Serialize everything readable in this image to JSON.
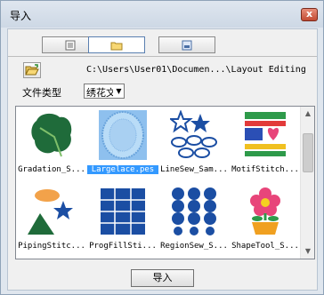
{
  "window": {
    "title": "导入",
    "close_glyph": "x"
  },
  "tabs": [
    {
      "icon": "list-icon",
      "selected": false
    },
    {
      "icon": "folder-icon",
      "selected": true
    },
    {
      "icon": "picture-icon",
      "selected": false
    }
  ],
  "folder": {
    "open_icon": "open-folder-icon",
    "path": "C:\\Users\\User01\\Documen...\\Layout  Editing"
  },
  "filter": {
    "label": "文件类型",
    "value": "绣花文"
  },
  "files": [
    {
      "name": "Gradation_S...",
      "icon": "leaf-icon",
      "selected": false
    },
    {
      "name": "Largelace.pes",
      "icon": "lace-oval-icon",
      "selected": true
    },
    {
      "name": "LineSew_Sam...",
      "icon": "stars-ovals-icon",
      "selected": false
    },
    {
      "name": "MotifStitch...",
      "icon": "motif-pattern-icon",
      "selected": false
    },
    {
      "name": "PipingStitc...",
      "icon": "piping-shapes-icon",
      "selected": false
    },
    {
      "name": "ProgFillSti...",
      "icon": "grid-tiles-icon",
      "selected": false
    },
    {
      "name": "RegionSew_S...",
      "icon": "circles-grid-icon",
      "selected": false
    },
    {
      "name": "ShapeTool_S...",
      "icon": "flower-pot-icon",
      "selected": false
    }
  ],
  "ok_button": {
    "label": "导入"
  },
  "colors": {
    "selection": "#3399ff",
    "leaf_green": "#1f6b3a",
    "tile_blue": "#1b4ea3"
  }
}
